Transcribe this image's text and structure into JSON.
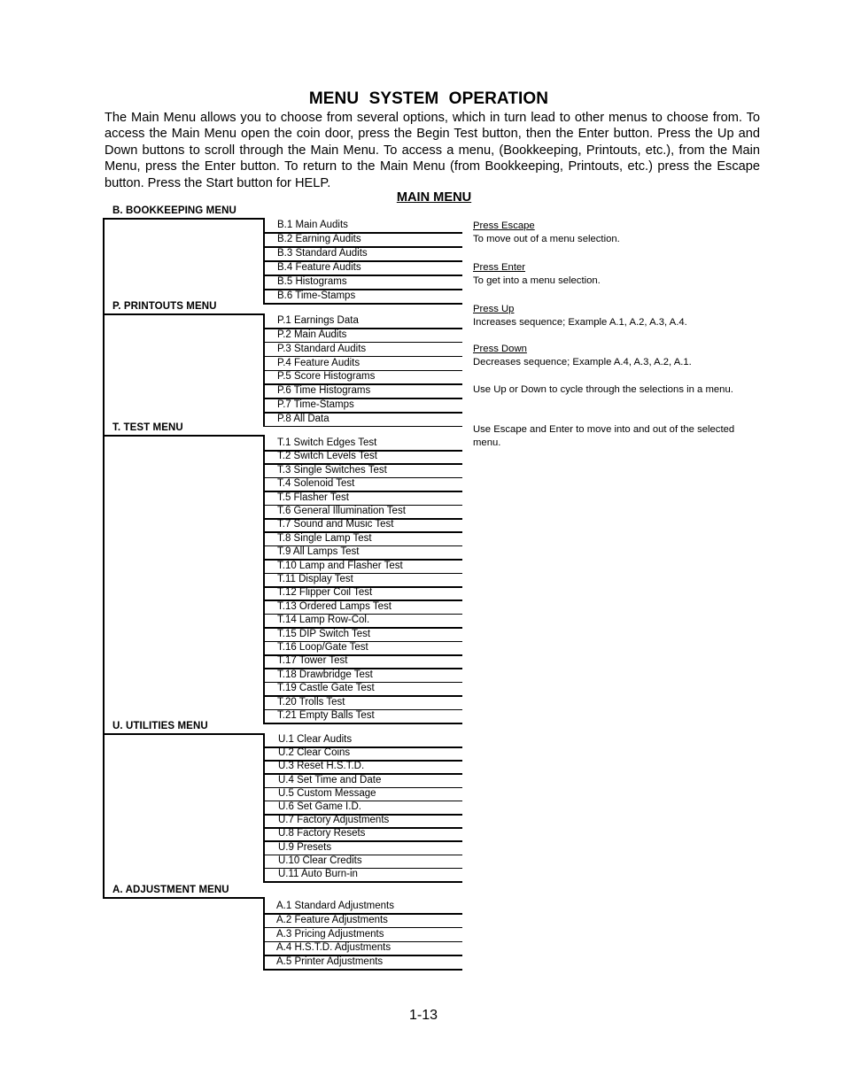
{
  "page": {
    "title": "MENU  SYSTEM  OPERATION",
    "intro": "The Main Menu allows you to choose from several options, which in turn lead to other menus to choose from.  To access the Main Menu open the coin door, press the Begin Test button, then the Enter button.  Press the Up and Down buttons to scroll through the Main Menu.  To access a menu, (Bookkeeping, Printouts, etc.), from the Main Menu, press the Enter button.  To return to the Main Menu (from Bookkeeping, Printouts, etc.) press the Escape button.  Press the Start button for HELP.",
    "subtitle": "MAIN MENU",
    "page_number": "1-13"
  },
  "menus": [
    {
      "id": "bookkeeping",
      "header": "B. BOOKKEEPING  MENU",
      "items": [
        "B.1 Main Audits",
        "B.2 Earning Audits",
        "B.3 Standard  Audits",
        "B.4 Feature Audits",
        "B.5 Histograms",
        "B.6 Time-Stamps"
      ]
    },
    {
      "id": "printouts",
      "header": "P.  PRINTOUTS MENU",
      "items": [
        "P.1  Earnings  Data",
        "P.2  Main Audits",
        "P.3  Standard Audits",
        "P.4  Feature Audits",
        "P.5  Score Histograms",
        "P.6  Time Histograms",
        "P.7  Time-Stamps",
        "P.8  All Data"
      ]
    },
    {
      "id": "test",
      "header": "T. TEST MENU",
      "items": [
        "T.1  Switch Edges Test",
        "T.2  Switch Levels Test",
        "T.3  Single Switches Test",
        "T.4  Solenoid Test",
        "T.5  Flasher Test",
        "T.6  General  Illumination Test",
        "T.7  Sound and  Music Test",
        "T.8  Single Lamp Test",
        "T.9  All Lamps Test",
        "T.10  Lamp and  Flasher Test",
        "T.11  Display Test",
        "T.12  Flipper Coil Test",
        "T.13  Ordered  Lamps Test",
        "T.14  Lamp Row-Col.",
        "T.15  DIP Switch Test",
        "T.16  Loop/Gate Test",
        "T.17  Tower Test",
        "T.18  Drawbridge Test",
        "T.19  Castle Gate Test",
        "T.20  Trolls Test",
        "T.21  Empty Balls Test"
      ]
    },
    {
      "id": "utilities",
      "header": "U.  UTILITIES MENU",
      "items": [
        "U.1  Clear Audits",
        "U.2  Clear Coins",
        "U.3  Reset  H.S.T.D.",
        "U.4   Set Time and Date",
        "U.5  Custom Message",
        "U.6  Set Game  I.D.",
        "U.7  Factory Adjustments",
        "U.8  Factory Resets",
        "U.9  Presets",
        "U.10  Clear Credits",
        "U.11  Auto Burn-in"
      ]
    },
    {
      "id": "adjustment",
      "header": "A.  ADJUSTMENT  MENU",
      "items": [
        "A.1  Standard Adjustments",
        "A.2  Feature Adjustments",
        "A.3  Pricing Adjustments",
        "A.4  H.S.T.D. Adjustments",
        "A.5  Printer Adjustments"
      ]
    }
  ],
  "help": [
    {
      "heading": "Press Escape",
      "text": "To move out of a menu selection."
    },
    {
      "heading": "Press Enter",
      "text": "To get into a menu selection."
    },
    {
      "heading": "Press Up",
      "text": "Increases sequence;  Example A.1, A.2, A.3, A.4."
    },
    {
      "heading": "Press Down",
      "text": "Decreases sequence; Example A.4, A.3, A.2, A.1."
    },
    {
      "heading": "",
      "text": "Use Up or Down to cycle through the selections in a menu."
    },
    {
      "heading": "",
      "text": "Use Escape and Enter to move into and out of the selected menu."
    }
  ]
}
